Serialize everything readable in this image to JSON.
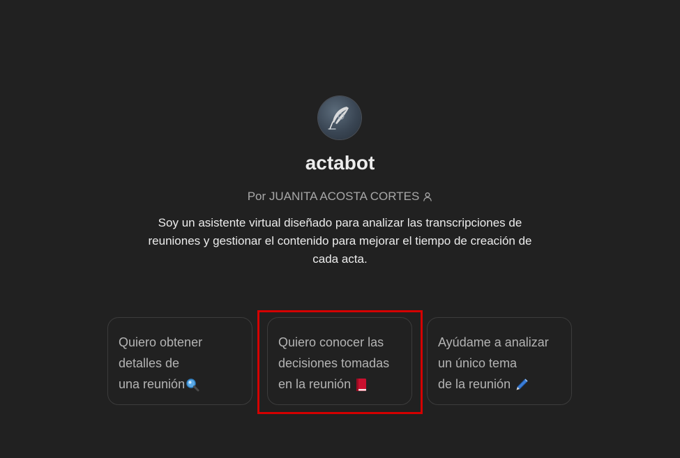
{
  "gpt": {
    "name": "actabot",
    "author": "Por JUANITA ACOSTA CORTES",
    "author_icon": "person-icon",
    "avatar_icon": "quill-feather-icon",
    "description": "Soy un asistente virtual diseñado para analizar las transcripciones de reuniones y gestionar el contenido para mejorar el tiempo de creación de cada acta."
  },
  "suggestions": [
    {
      "lines": [
        "Quiero obtener",
        "detalles de",
        "una reunión"
      ],
      "emoji": "magnifying-glass-icon"
    },
    {
      "lines": [
        "Quiero conocer las",
        "decisiones tomadas",
        "en la reunión"
      ],
      "emoji": "closed-book-icon"
    },
    {
      "lines": [
        "Ayúdame a analizar",
        "un único tema",
        "de la reunión"
      ],
      "emoji": "pen-icon"
    }
  ],
  "colors": {
    "background": "#212121",
    "highlight": "#d40000"
  }
}
